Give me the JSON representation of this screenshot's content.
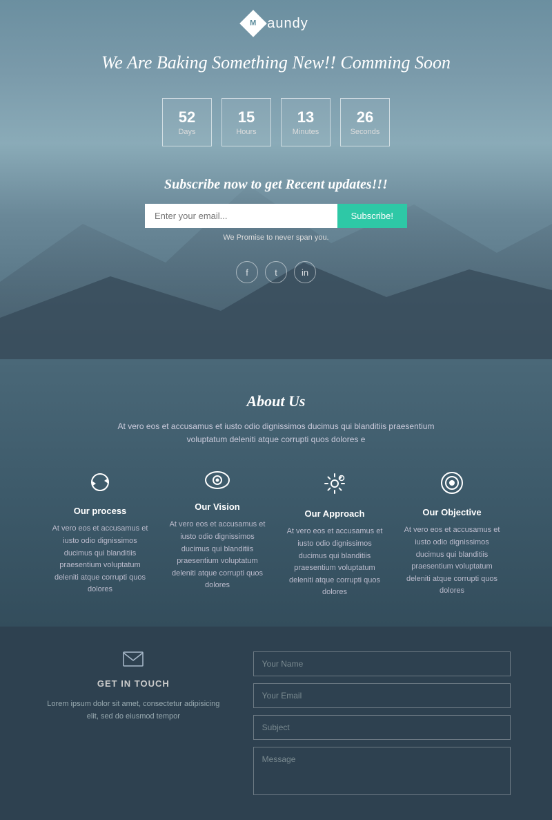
{
  "logo": {
    "diamond_letter": "M",
    "name": "aundy"
  },
  "hero": {
    "headline": "We Are Baking Something New!! Comming Soon"
  },
  "countdown": {
    "days": {
      "value": "52",
      "label": "Days"
    },
    "hours": {
      "value": "15",
      "label": "Hours"
    },
    "minutes": {
      "value": "13",
      "label": "Minutes"
    },
    "seconds": {
      "value": "26",
      "label": "Seconds"
    }
  },
  "subscribe": {
    "title": "Subscribe now to get Recent updates!!!",
    "input_placeholder": "Enter your email...",
    "button_label": "Subscribe!",
    "note": "We Promise to never span you."
  },
  "social": {
    "facebook": "f",
    "twitter": "t",
    "linkedin": "in"
  },
  "about": {
    "title": "About Us",
    "description": "At vero eos et accusamus et iusto odio dignissimos ducimus qui blanditiis praesentium voluptatum deleniti atque corrupti quos dolores e"
  },
  "features": [
    {
      "title": "Our process",
      "text": "At vero eos et accusamus et iusto odio dignissimos ducimus qui blanditiis praesentium voluptatum deleniti atque corrupti quos dolores",
      "icon": "refresh"
    },
    {
      "title": "Our Vision",
      "text": "At vero eos et accusamus et iusto odio dignissimos ducimus qui blanditiis praesentium voluptatum deleniti atque corrupti quos dolores",
      "icon": "eye"
    },
    {
      "title": "Our Approach",
      "text": "At vero eos et accusamus et iusto odio dignissimos ducimus qui blanditiis praesentium voluptatum deleniti atque corrupti quos dolores",
      "icon": "settings"
    },
    {
      "title": "Our Objective",
      "text": "At vero eos et accusamus et iusto odio dignissimos ducimus qui blanditiis praesentium voluptatum deleniti atque corrupti quos dolores",
      "icon": "target"
    }
  ],
  "get_in_touch": {
    "section_title": "GET IN TOUCH",
    "body_text": "Lorem ipsum dolor sit amet, consectetur adipisicing elit, sed do eiusmod tempor"
  },
  "contact_form": {
    "name_placeholder": "Your Name",
    "email_placeholder": "Your Email",
    "subject_placeholder": "Subject",
    "message_placeholder": "Message"
  }
}
